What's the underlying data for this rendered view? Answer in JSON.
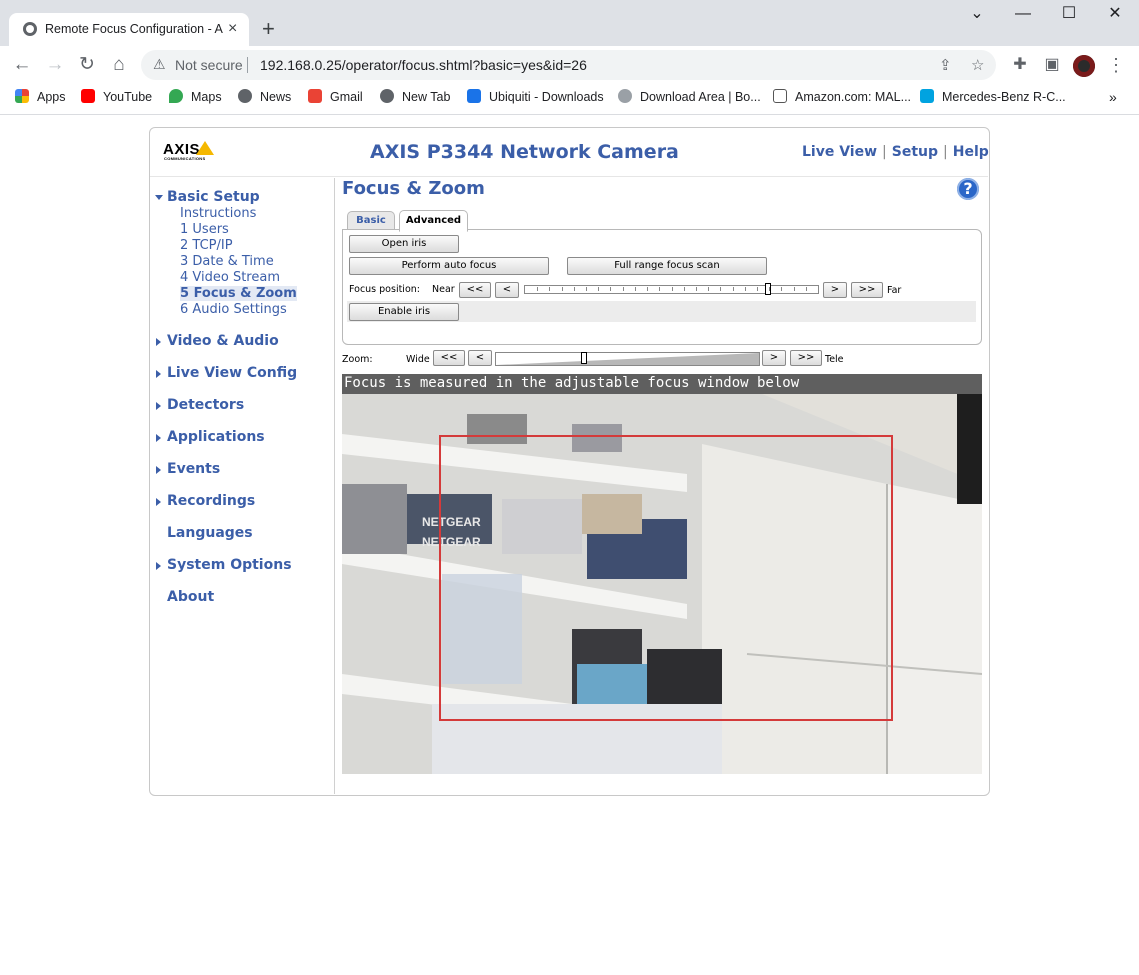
{
  "browser": {
    "tab_title": "Remote Focus Configuration - AXIS",
    "tab_close": "×",
    "new_tab": "+",
    "security_label": "Not secure",
    "url": "192.168.0.25/operator/focus.shtml?basic=yes&id=26",
    "bookmarks": [
      "Apps",
      "YouTube",
      "Maps",
      "News",
      "Gmail",
      "New Tab",
      "Ubiquiti - Downloads",
      "Download Area | Bo...",
      "Amazon.com: MAL...",
      "Mercedes-Benz R-C..."
    ],
    "bookmarks_more": "»"
  },
  "header": {
    "logo": "AXIS",
    "logo_sub": "COMMUNICATIONS",
    "title": "AXIS P3344 Network Camera",
    "links": [
      "Live View",
      "Setup",
      "Help"
    ]
  },
  "sidebar": {
    "basic_setup": {
      "label": "Basic Setup",
      "items": [
        "Instructions",
        "1 Users",
        "2 TCP/IP",
        "3 Date & Time",
        "4 Video Stream",
        "5 Focus & Zoom",
        "6 Audio Settings"
      ],
      "active": "5 Focus & Zoom"
    },
    "sections": [
      "Video & Audio",
      "Live View Config",
      "Detectors",
      "Applications",
      "Events",
      "Recordings",
      "Languages",
      "System Options",
      "About"
    ]
  },
  "main": {
    "title": "Focus & Zoom",
    "help_icon": "?",
    "tabs": [
      "Basic",
      "Advanced"
    ],
    "active_tab": "Advanced",
    "buttons": {
      "open_iris": "Open iris",
      "auto_focus": "Perform auto focus",
      "full_scan": "Full range focus scan",
      "enable_iris": "Enable iris"
    },
    "focus": {
      "label": "Focus position:",
      "near": "Near",
      "far": "Far",
      "btn_fast_back": "<<",
      "btn_back": "<",
      "btn_fwd": ">",
      "btn_fast_fwd": ">>",
      "position": 0.83
    },
    "zoom": {
      "label": "Zoom:",
      "wide": "Wide",
      "tele": "Tele",
      "btn_fast_back": "<<",
      "btn_back": "<",
      "btn_fwd": ">",
      "btn_fast_fwd": ">>",
      "position": 0.34
    },
    "video_caption": "Focus is measured in the adjustable focus window below",
    "video_labels": [
      "NETGEAR",
      "NETGEAR"
    ]
  },
  "colors": {
    "accent": "#3b5ea8",
    "focus_window": "#d43a3a"
  }
}
